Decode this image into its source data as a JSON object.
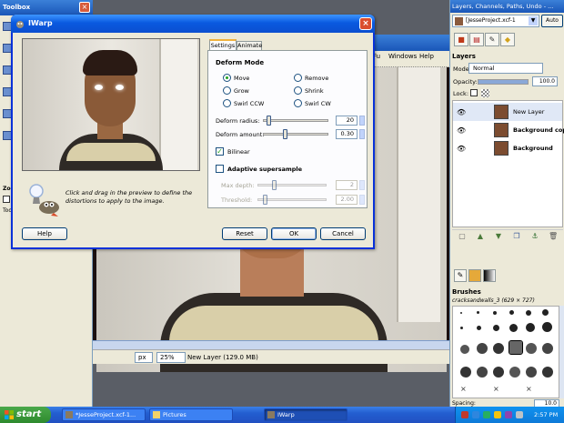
{
  "canvas": {
    "menu": [
      "Fu",
      "Windows",
      "Help"
    ],
    "unit": "px",
    "zoom": "25%",
    "status": "New Layer (129.0 MB)"
  },
  "toolbox": {
    "title": "Toolbox",
    "zoom_label": "Zoo",
    "tools_label": "Too"
  },
  "dock": {
    "title": "Layers, Channels, Paths, Undo - ...",
    "image_select": "[JesseProject.xcf-1",
    "auto_label": "Auto",
    "layers_heading": "Layers",
    "mode_label": "Mode:",
    "mode_value": "Normal",
    "opacity_label": "Opacity:",
    "opacity_value": "100.0",
    "opacity_level": 1.0,
    "lock_label": "Lock:",
    "layers": [
      {
        "name": "New Layer",
        "visible": true,
        "selected": true
      },
      {
        "name": "Background copy",
        "visible": true,
        "selected": false
      },
      {
        "name": "Background",
        "visible": true,
        "selected": false
      }
    ],
    "brushes_heading": "Brushes",
    "brush_name": "cracksandwalls_3 (629 × 727)",
    "spacing_label": "Spacing:",
    "spacing_value": "10.0"
  },
  "iwarp": {
    "title": "IWarp",
    "tabs": [
      "Settings",
      "Animate"
    ],
    "help_text": "Click and drag in the preview to define the distortions to apply to the image.",
    "deform_mode_heading": "Deform Mode",
    "modes": [
      "Move",
      "Remove",
      "Grow",
      "Shrink",
      "Swirl CCW",
      "Swirl CW"
    ],
    "selected_mode": "Move",
    "deform_radius_label": "Deform radius:",
    "deform_radius_value": "20",
    "deform_amount_label": "Deform amount:",
    "deform_amount_value": "0.30",
    "bilinear_label": "Bilinear",
    "bilinear_checked": true,
    "adaptive_label": "Adaptive supersample",
    "adaptive_checked": false,
    "max_depth_label": "Max depth:",
    "max_depth_value": "2",
    "threshold_label": "Threshold:",
    "threshold_value": "2.00",
    "buttons": {
      "help": "Help",
      "reset": "Reset",
      "ok": "OK",
      "cancel": "Cancel"
    }
  },
  "taskbar": {
    "start": "start",
    "tasks": [
      "*JesseProject.xcf-1...",
      "Pictures",
      "IWarp"
    ],
    "clock": "2:57 PM"
  }
}
